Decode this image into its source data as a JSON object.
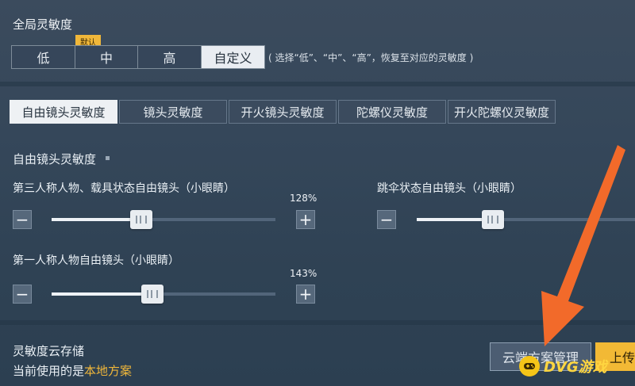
{
  "header": {
    "title": "全局灵敏度"
  },
  "presets": {
    "badge": "默认",
    "options": [
      "低",
      "中",
      "高",
      "自定义"
    ],
    "selected": "自定义",
    "hint": "( 选择“低”、“中”、“高”，恢复至对应的灵敏度 )"
  },
  "tabs": [
    "自由镜头灵敏度",
    "镜头灵敏度",
    "开火镜头灵敏度",
    "陀螺仪灵敏度",
    "开火陀螺仪灵敏度"
  ],
  "section": {
    "title": "自由镜头灵敏度"
  },
  "sliders": [
    {
      "label": "第三人称人物、载具状态自由镜头（小眼睛）",
      "value_text": "128%",
      "level": 0.4,
      "minus": "−",
      "plus": "+"
    },
    {
      "label": "第一人称人物自由镜头（小眼睛）",
      "value_text": "143%",
      "level": 0.45,
      "minus": "−",
      "plus": "+"
    },
    {
      "label": "跳伞状态自由镜头（小眼睛）",
      "value_text": "",
      "level": 0.35,
      "minus": "−",
      "plus": "+"
    }
  ],
  "cloud": {
    "title": "灵敏度云存储",
    "current_prefix": "当前使用的是",
    "current_value": "本地方案",
    "manage_label": "云端方案管理",
    "upload_label": "上传"
  },
  "overlay": {
    "watermark": "DVG游戏"
  },
  "colors": {
    "accent": "#f0b73a",
    "arrow": "#f26a2a",
    "current_value": "#f0b73a"
  }
}
